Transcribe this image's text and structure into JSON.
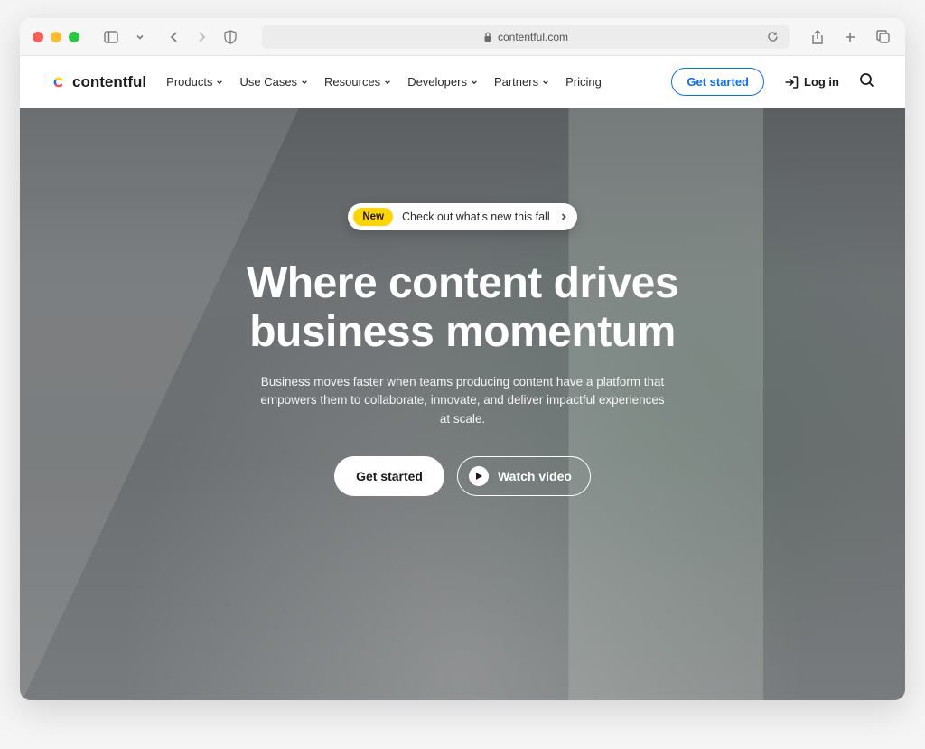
{
  "browser": {
    "url": "contentful.com"
  },
  "header": {
    "logo_text": "contentful",
    "nav": [
      {
        "label": "Products",
        "dropdown": true
      },
      {
        "label": "Use Cases",
        "dropdown": true
      },
      {
        "label": "Resources",
        "dropdown": true
      },
      {
        "label": "Developers",
        "dropdown": true
      },
      {
        "label": "Partners",
        "dropdown": true
      },
      {
        "label": "Pricing",
        "dropdown": false
      }
    ],
    "cta": "Get started",
    "login": "Log in"
  },
  "hero": {
    "pill_badge": "New",
    "pill_text": "Check out what's new this fall",
    "title_line1": "Where content drives",
    "title_line2": "business momentum",
    "subtitle": "Business moves faster when teams producing content have a platform that empowers them to collaborate, innovate, and deliver impactful experiences at scale.",
    "primary_cta": "Get started",
    "secondary_cta": "Watch video"
  }
}
